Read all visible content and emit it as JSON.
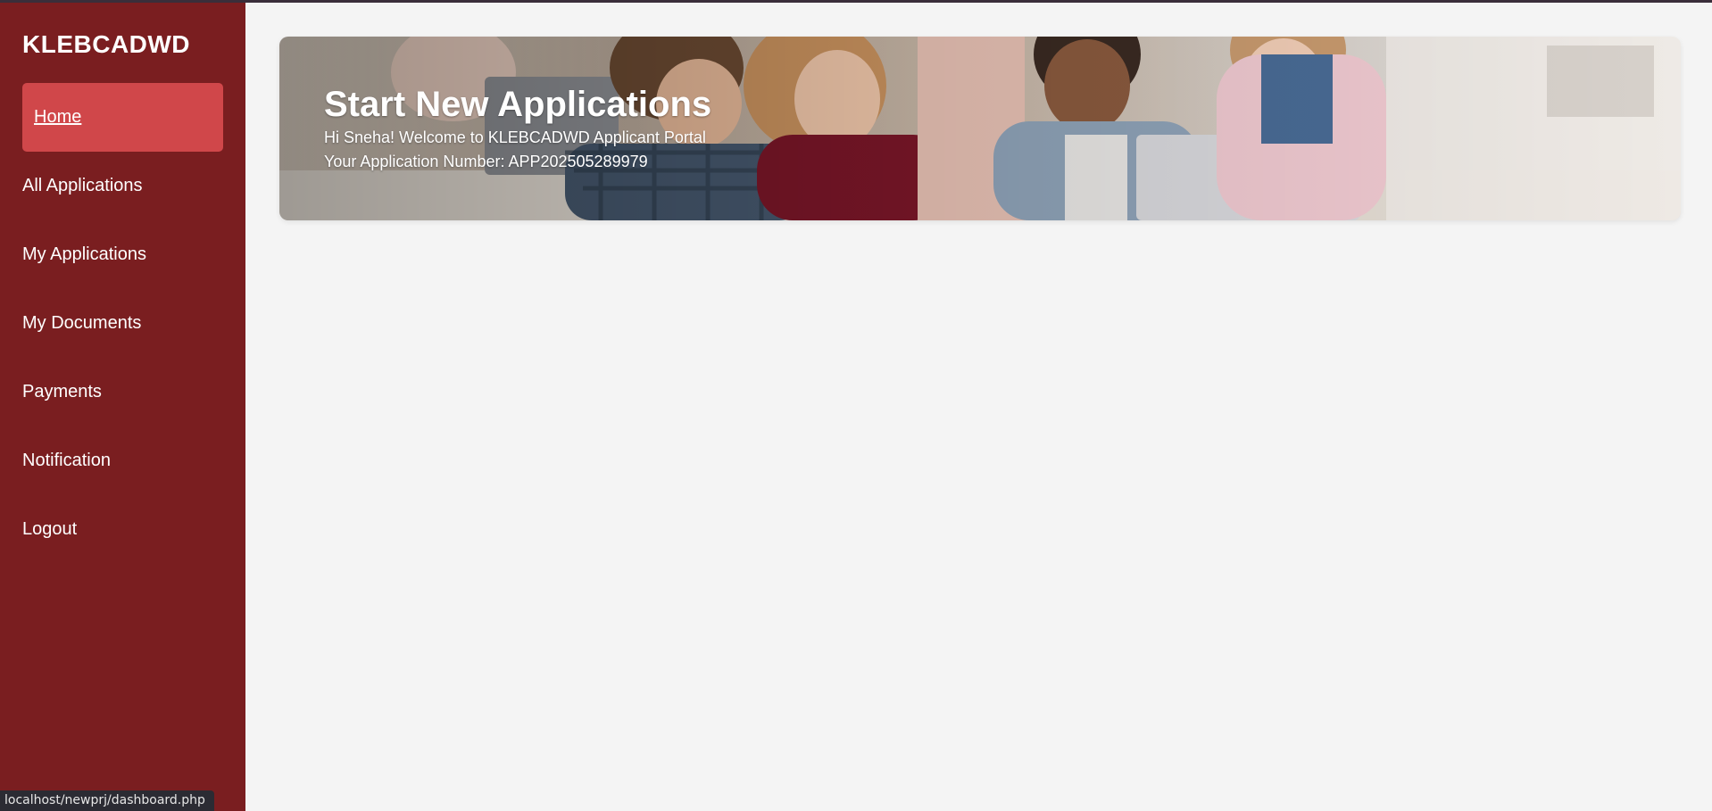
{
  "sidebar": {
    "brand": "KLEBCADWD",
    "items": [
      {
        "label": "Home",
        "active": true
      },
      {
        "label": "All Applications"
      },
      {
        "label": "My Applications"
      },
      {
        "label": "My Documents"
      },
      {
        "label": "Payments"
      },
      {
        "label": "Notification"
      },
      {
        "label": "Logout"
      }
    ]
  },
  "banner": {
    "title": "Start New Applications",
    "greeting": "Hi Sneha! Welcome to KLEBCADWD Applicant Portal",
    "app_number_line": "Your Application Number: APP202505289979"
  },
  "statusbar": {
    "url": "localhost/newprj/dashboard.php"
  },
  "colors": {
    "sidebar_bg": "#7a1e20",
    "active_item_bg": "#d0474a",
    "main_bg": "#f4f4f4"
  }
}
